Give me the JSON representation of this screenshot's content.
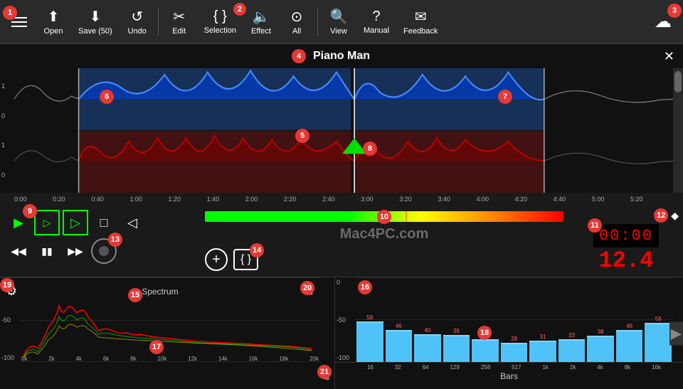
{
  "toolbar": {
    "menu_icon": "☰",
    "open_label": "Open",
    "save_label": "Save (50)",
    "undo_label": "Undo",
    "edit_label": "Edit",
    "selection_label": "Selection",
    "effect_label": "Effect",
    "all_label": "All",
    "view_label": "View",
    "manual_label": "Manual",
    "feedback_label": "Feedback",
    "selection_badge": "2"
  },
  "title_bar": {
    "title": "Piano Man",
    "close": "✕",
    "badge_num": "4"
  },
  "timeline": {
    "marks": [
      "0:00",
      "0:20",
      "0:40",
      "1:00",
      "1:20",
      "1:40",
      "2:00",
      "2:20",
      "2:40",
      "3:00",
      "3:20",
      "3:40",
      "4:00",
      "4:20",
      "4:40",
      "5:00",
      "5:20"
    ]
  },
  "transport": {
    "play": "▶",
    "play_from": "▷",
    "play_sel": "▷",
    "stop": "□",
    "vol": "◁",
    "rewind": "◀◀",
    "pause": "⏸",
    "ffwd": "▶▶",
    "time": "00:00",
    "time_decimal": "12.4",
    "plus_btn": "+",
    "bracket_label": "{ }",
    "watermark": "Mac4PC.com"
  },
  "spectrum": {
    "title": "Spectrum",
    "bars_title": "Bars",
    "y_labels": [
      "0",
      "-50",
      "-100"
    ],
    "x_labels_spectrum": [
      "0k",
      "2k",
      "4k",
      "6k",
      "8k",
      "10k",
      "12k",
      "14k",
      "16k",
      "18k",
      "20k"
    ],
    "x_labels_bars": [
      "16",
      "32",
      "64",
      "129",
      "258",
      "517",
      "1k",
      "2k",
      "4k",
      "8k",
      "16k"
    ],
    "bar_values": [
      58,
      46,
      40,
      39,
      33,
      28,
      31,
      33,
      38,
      46,
      56
    ],
    "bar_heights_pct": [
      58,
      46,
      40,
      39,
      33,
      28,
      31,
      33,
      38,
      46,
      56
    ],
    "badge_num_16": "16",
    "badge_num_18": "18"
  },
  "annotations": {
    "n1": "1",
    "n2": "2",
    "n3": "3",
    "n4": "4",
    "n5": "5",
    "n6": "6",
    "n7": "7",
    "n8": "8",
    "n9": "9",
    "n10": "10",
    "n11": "11",
    "n12": "12",
    "n13": "13",
    "n14": "14",
    "n15": "15",
    "n16": "16",
    "n17": "17",
    "n18": "18",
    "n19": "19",
    "n20": "20",
    "n21": "21"
  },
  "colors": {
    "accent_red": "#e53935",
    "accent_green": "#00e676",
    "waveform_blue": "#1565c0",
    "waveform_red": "#b71c1c",
    "bar_blue": "#4fc3f7",
    "bg_dark": "#111111",
    "bg_mid": "#1a1a1a",
    "toolbar_bg": "#2a2a2a"
  }
}
